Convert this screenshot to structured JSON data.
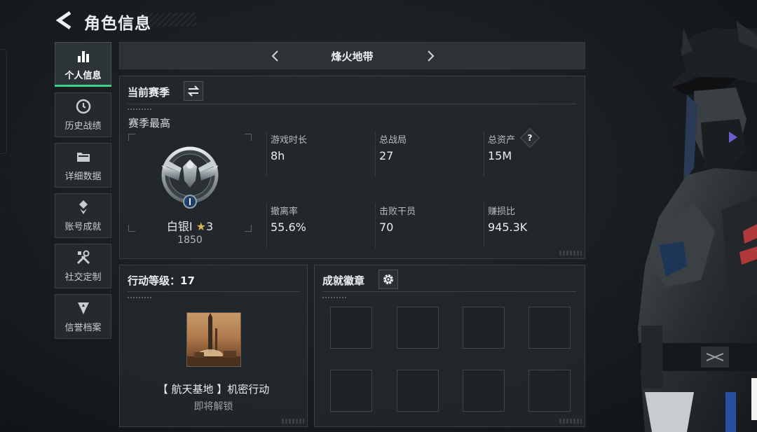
{
  "header": {
    "title": "角色信息",
    "back_icon": "back-arrow-icon"
  },
  "sidebar": {
    "items": [
      {
        "label": "个人信息",
        "icon": "bar-chart-icon",
        "active": true
      },
      {
        "label": "历史战绩",
        "icon": "history-icon",
        "active": false
      },
      {
        "label": "详细数据",
        "icon": "folder-icon",
        "active": false
      },
      {
        "label": "账号成就",
        "icon": "achievement-icon",
        "active": false
      },
      {
        "label": "社交定制",
        "icon": "tools-icon",
        "active": false
      },
      {
        "label": "信誉档案",
        "icon": "credit-shield-icon",
        "active": false
      }
    ]
  },
  "mode": {
    "name": "烽火地带"
  },
  "season": {
    "title": "当前赛季",
    "best_label": "赛季最高",
    "rank_name": "白银I",
    "star_count": "3",
    "rank_score": "1850",
    "stats": [
      {
        "label": "游戏时长",
        "value": "8h"
      },
      {
        "label": "总战局",
        "value": "27"
      },
      {
        "label": "总资产",
        "value": "15M"
      },
      {
        "label": "撤离率",
        "value": "55.6%"
      },
      {
        "label": "击败干员",
        "value": "70"
      },
      {
        "label": "赚损比",
        "value": "945.3K"
      }
    ],
    "help_icon_text": "?"
  },
  "action_level": {
    "title": "行动等级：17",
    "mission_name": "【 航天基地 】机密行动",
    "mission_status": "即将解锁"
  },
  "badges": {
    "title": "成就徽章",
    "slot_count": 8
  },
  "colors": {
    "accent": "#3fd18b",
    "star": "#d9b457",
    "background": "#1b2023"
  }
}
